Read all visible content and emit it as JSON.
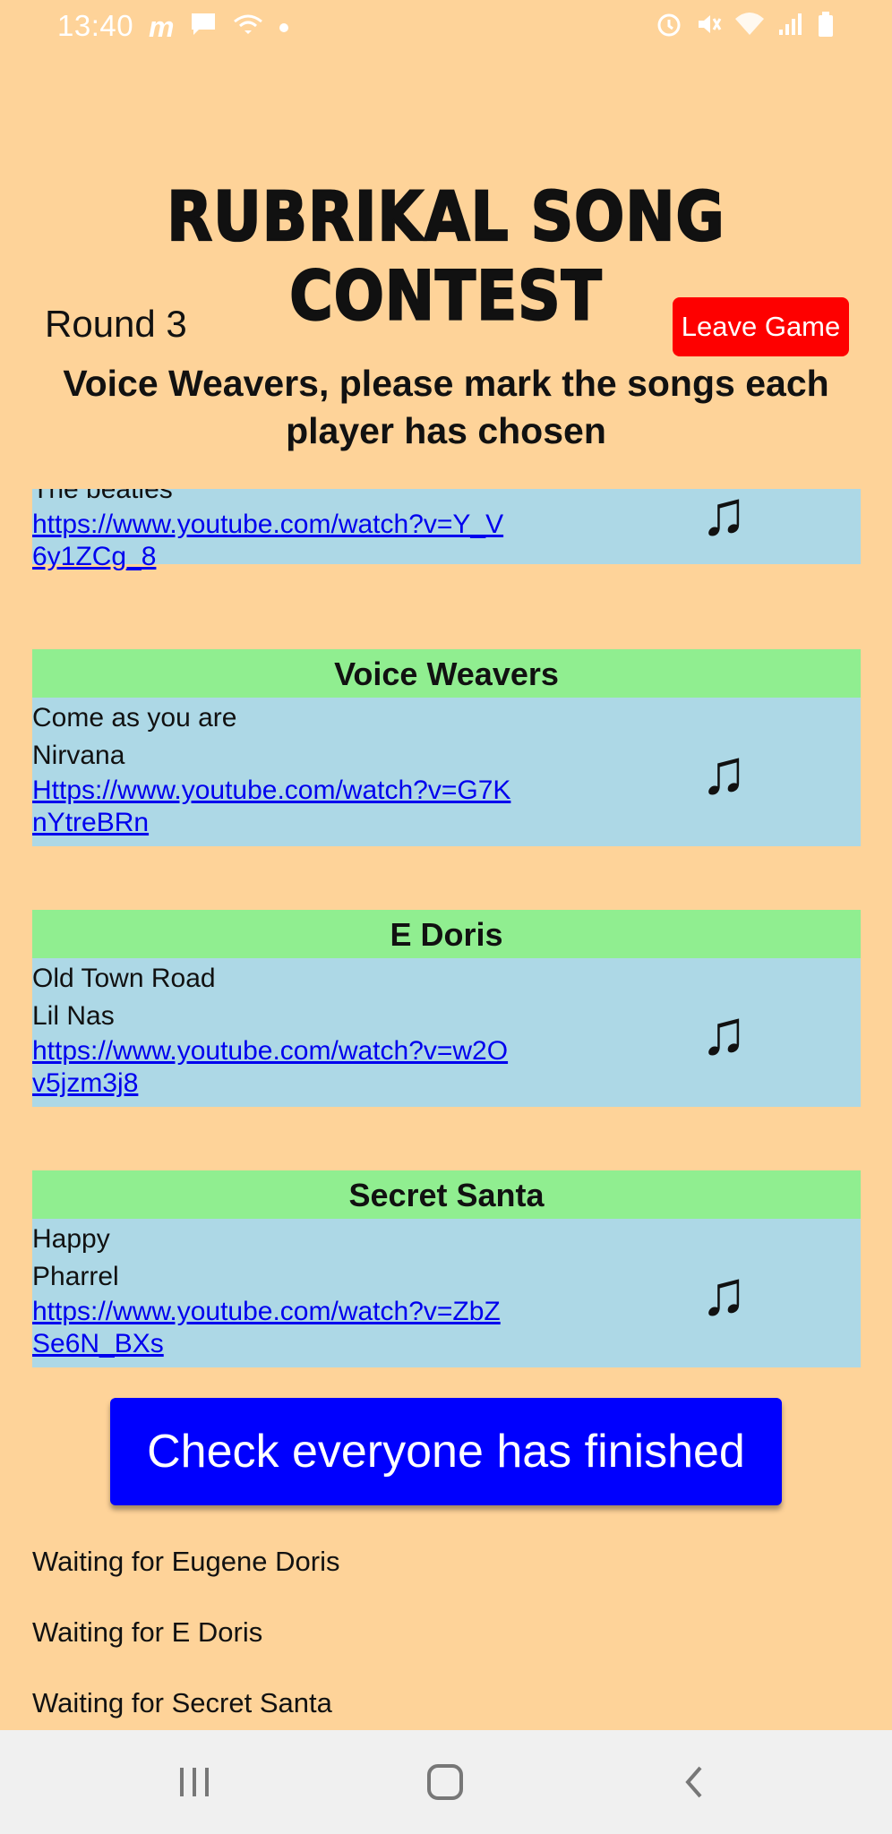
{
  "status_bar": {
    "time": "13:40",
    "left_icons": [
      "messenger-m-icon",
      "chat-bubble-icon",
      "wifi-calling-icon",
      "dot-icon"
    ],
    "right_icons": [
      "alarm-icon",
      "mute-icon",
      "wifi-icon",
      "signal-icon",
      "battery-icon"
    ]
  },
  "header": {
    "title": "RUBRIKAL SONG CONTEST",
    "round": "Round 3",
    "leave_button": "Leave Game",
    "instruction": "Voice Weavers, please mark the songs each player has chosen"
  },
  "partial_card": {
    "artist": "The beatles",
    "link": "https://www.youtube.com/watch?v=Y_V6y1ZCg_8"
  },
  "songs": [
    {
      "player": "Voice Weavers",
      "title": "Come as you are",
      "artist": "Nirvana",
      "link": "Https://www.youtube.com/watch?v=G7KnYtreBRn"
    },
    {
      "player": "E Doris",
      "title": "Old Town Road",
      "artist": "Lil Nas",
      "link": "https://www.youtube.com/watch?v=w2Ov5jzm3j8"
    },
    {
      "player": "Secret Santa",
      "title": "Happy",
      "artist": "Pharrel",
      "link": "https://www.youtube.com/watch?v=ZbZSe6N_BXs"
    }
  ],
  "check_button": "Check everyone has finished",
  "waiting": [
    "Waiting for Eugene Doris",
    "Waiting for E Doris",
    "Waiting for Secret Santa"
  ],
  "nav_bar": {
    "icons": [
      "recent-apps-icon",
      "home-icon",
      "back-icon"
    ]
  },
  "colors": {
    "background": "#FED399",
    "card_header": "#90EE90",
    "card_body": "#ADD8E6",
    "leave_button": "#FE0000",
    "check_button": "#0000FE",
    "link": "#0000EE"
  }
}
